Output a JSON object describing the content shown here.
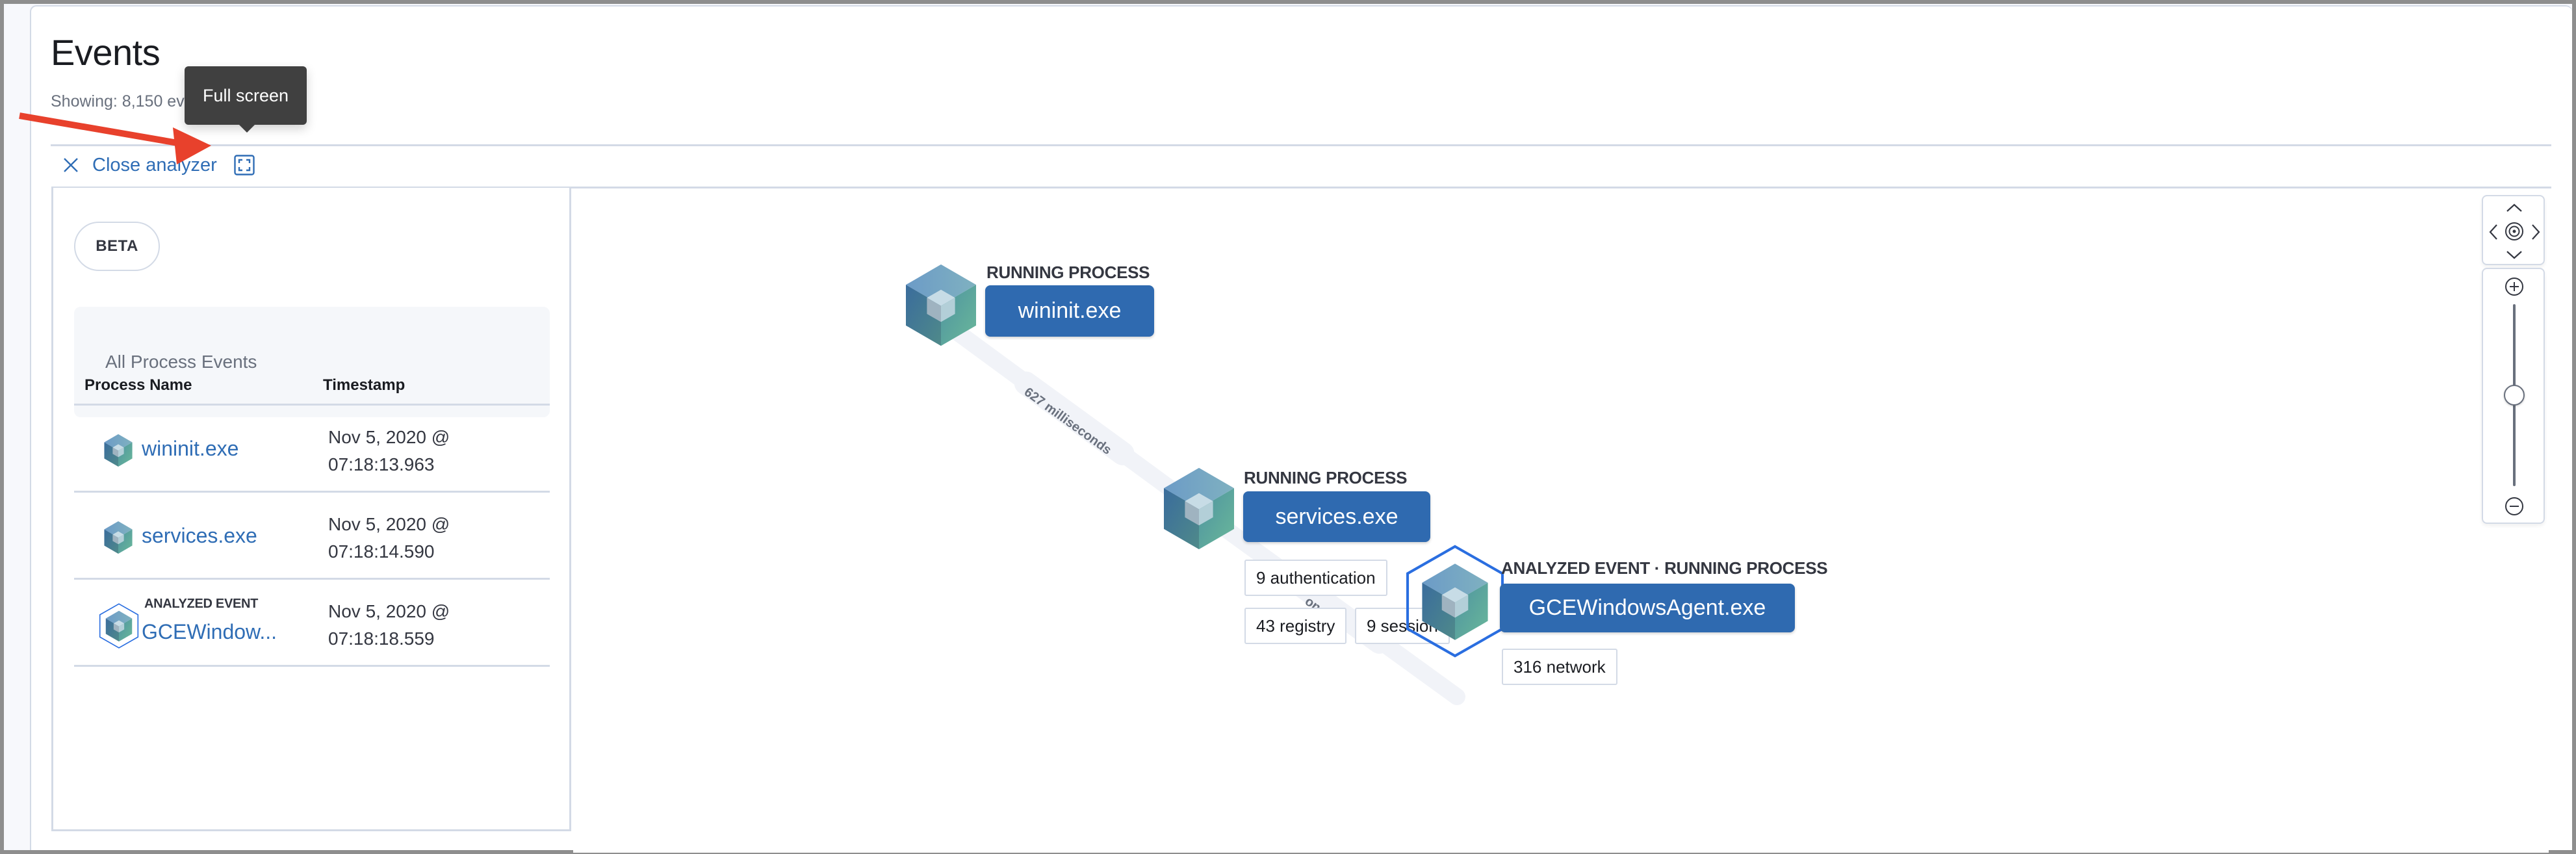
{
  "header": {
    "title": "Events",
    "showing": "Showing: 8,150 eve"
  },
  "toolbar": {
    "close_label": "Close analyzer",
    "close_icon": "close-icon",
    "fullscreen_icon": "fullscreen-icon"
  },
  "tooltip": {
    "text": "Full screen"
  },
  "annotation": {
    "arrow_color": "#e8412c"
  },
  "sidebar": {
    "badge": "BETA",
    "section_title": "All Process Events",
    "columns": [
      "Process Name",
      "Timestamp"
    ],
    "rows": [
      {
        "name": "wininit.exe",
        "kicker": "",
        "date": "Nov 5, 2020 @",
        "time": "07:18:13.963",
        "analyzed": false
      },
      {
        "name": "services.exe",
        "kicker": "",
        "date": "Nov 5, 2020 @",
        "time": "07:18:14.590",
        "analyzed": false
      },
      {
        "name": "GCEWindow...",
        "kicker": "ANALYZED EVENT",
        "date": "Nov 5, 2020 @",
        "time": "07:18:18.559",
        "analyzed": true
      }
    ]
  },
  "graph": {
    "nodes": [
      {
        "kicker": "RUNNING PROCESS",
        "name": "wininit.exe",
        "badges": [],
        "analyzed": false
      },
      {
        "kicker": "RUNNING PROCESS",
        "name": "services.exe",
        "badges": [
          "9 authentication",
          "43 registry",
          "9 session"
        ],
        "analyzed": false
      },
      {
        "kicker": "ANALYZED EVENT · RUNNING PROCESS",
        "name": "GCEWindowsAgent.exe",
        "badges": [
          "316 network"
        ],
        "analyzed": true
      }
    ],
    "edges": [
      {
        "label": "627 milliseconds"
      },
      {
        "label": "onds"
      }
    ],
    "colors": {
      "node_button": "#2f6ab0",
      "link": "#2f6db5",
      "analyzed_ring": "#2a6ee0",
      "edge": "#f1f3f8"
    }
  },
  "controls": {
    "pan_icons": [
      "chevron-up-icon",
      "chevron-left-icon",
      "center-target-icon",
      "chevron-right-icon",
      "chevron-down-icon"
    ],
    "zoom_in_icon": "zoom-in-icon",
    "zoom_out_icon": "zoom-out-icon",
    "zoom_level": 0.5
  }
}
